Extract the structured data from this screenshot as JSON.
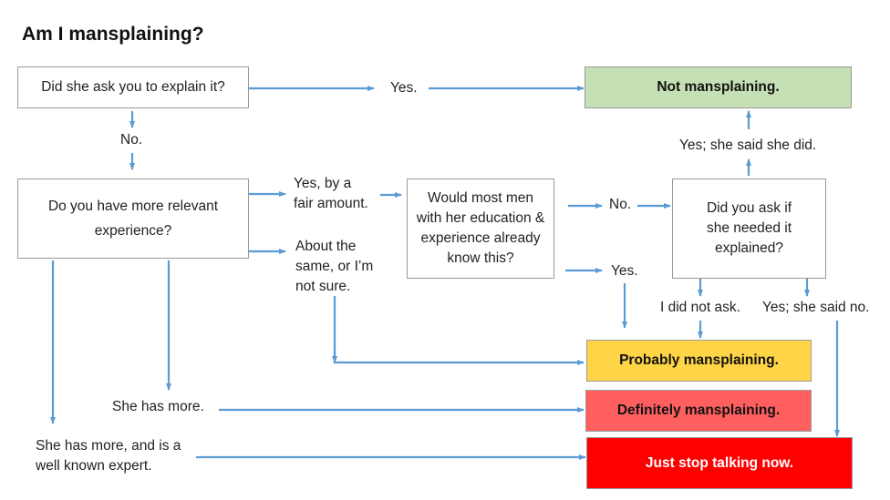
{
  "title": "Am I mansplaining?",
  "colors": {
    "arrow": "#5b9bd5",
    "box_border": "#9a9a9a",
    "not_mansplaining": "#c5e0b4",
    "probably": "#ffd447",
    "definitely": "#ff5f5f",
    "stop": "#ff0000"
  },
  "nodes": {
    "q_ask": "Did she ask you to explain it?",
    "q_experience": "Do you have more relevant experience?",
    "q_most_men": "Would most men with her education & experience already know this?",
    "q_did_you_ask": "Did you ask if she needed it explained?"
  },
  "outcomes": {
    "not": "Not mansplaining.",
    "probably": "Probably mansplaining.",
    "definitely": "Definitely mansplaining.",
    "stop": "Just stop talking now."
  },
  "labels": {
    "yes_top": "Yes.",
    "no_left": "No.",
    "yes_fair_1": "Yes, by a",
    "yes_fair_2": "fair amount.",
    "about_1": "About the",
    "about_2": "same, or I’m",
    "about_3": "not sure.",
    "no_mid": "No.",
    "yes_mid": "Yes.",
    "yes_she_did": "Yes; she said she did.",
    "did_not_ask": "I did not ask.",
    "yes_she_said_no": "Yes; she said no.",
    "she_has_more": "She has more.",
    "expert_1": "She has more, and is a",
    "expert_2": "well known expert."
  }
}
